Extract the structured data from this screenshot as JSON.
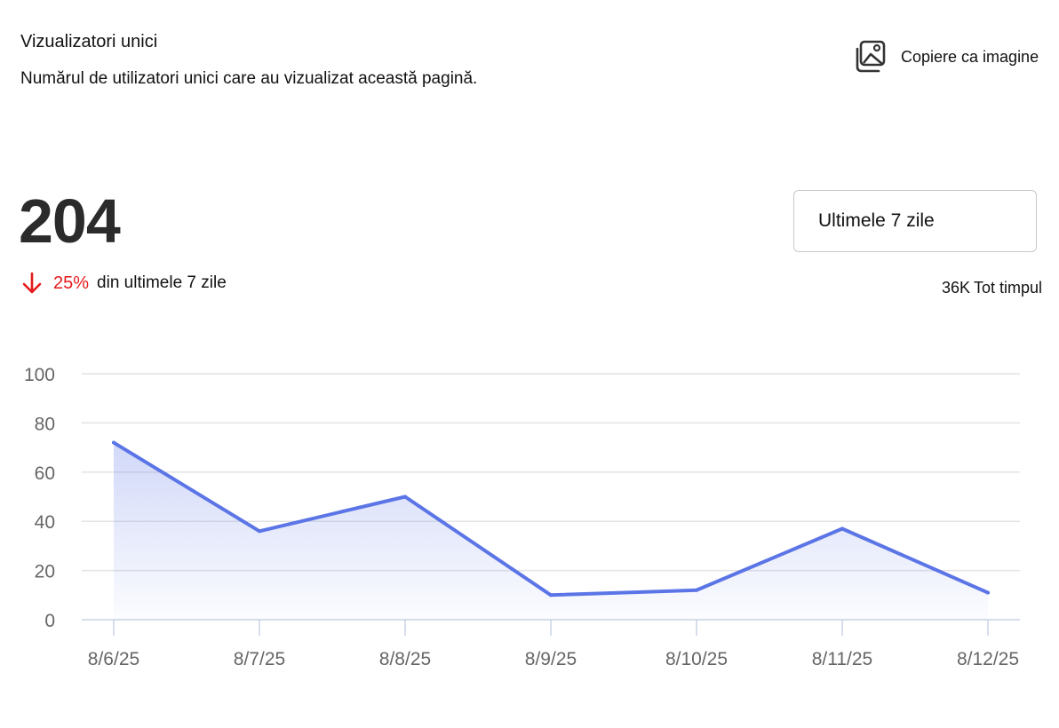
{
  "header": {
    "title": "Vizualizatori unici",
    "subtitle": "Numărul de utilizatori unici care au vizualizat această pagină.",
    "copy_label": "Copiere ca imagine",
    "copy_icon": "image-icon"
  },
  "summary": {
    "value": "204",
    "change_direction_icon": "arrow-down-icon",
    "change_percent": "25%",
    "change_text": "din ultimele 7 zile",
    "change_color": "#e61a1a"
  },
  "period": {
    "selected": "Ultimele 7 zile"
  },
  "all_time": {
    "value": "36K",
    "label": "Tot timpul"
  },
  "chart_data": {
    "type": "area",
    "title": "",
    "xlabel": "",
    "ylabel": "",
    "x": [
      "8/6/25",
      "8/7/25",
      "8/8/25",
      "8/9/25",
      "8/10/25",
      "8/11/25",
      "8/12/25"
    ],
    "series": [
      {
        "values": [
          72,
          36,
          50,
          10,
          12,
          37,
          11
        ],
        "color": "#5b75e6"
      }
    ],
    "y_ticks": [
      0,
      20,
      40,
      60,
      80,
      100
    ],
    "ylim": [
      0,
      100
    ],
    "grid": true,
    "legend": "none"
  }
}
